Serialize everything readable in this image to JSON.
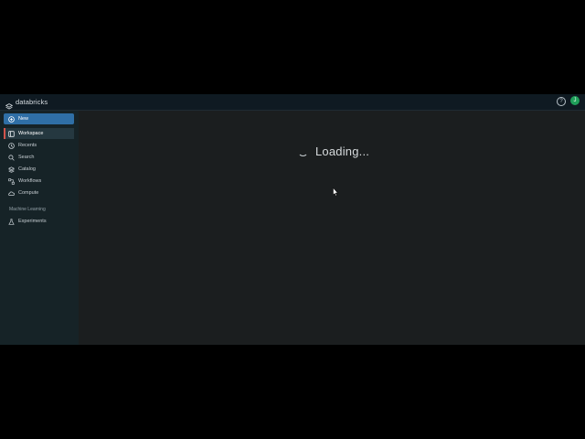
{
  "app": {
    "brand": "databricks",
    "help_icon": "help-circle-icon",
    "avatar_initial": "J"
  },
  "sidebar": {
    "new_label": "New",
    "items": [
      {
        "label": "Workspace",
        "icon": "workspace-icon",
        "active": true
      },
      {
        "label": "Recents",
        "icon": "clock-icon"
      },
      {
        "label": "Search",
        "icon": "search-icon"
      },
      {
        "label": "Catalog",
        "icon": "catalog-icon"
      },
      {
        "label": "Workflows",
        "icon": "workflows-icon"
      },
      {
        "label": "Compute",
        "icon": "cloud-icon"
      }
    ],
    "section_label": "Machine Learning",
    "ml_items": [
      {
        "label": "Experiments",
        "icon": "flask-icon"
      }
    ]
  },
  "main": {
    "loading_text": "Loading..."
  },
  "colors": {
    "topbar": "#0f1a22",
    "sidebar": "#162327",
    "main": "#1b1e1f",
    "new_button": "#2f6fa6",
    "active_marker": "#d2534b",
    "avatar": "#1f9f5a"
  }
}
